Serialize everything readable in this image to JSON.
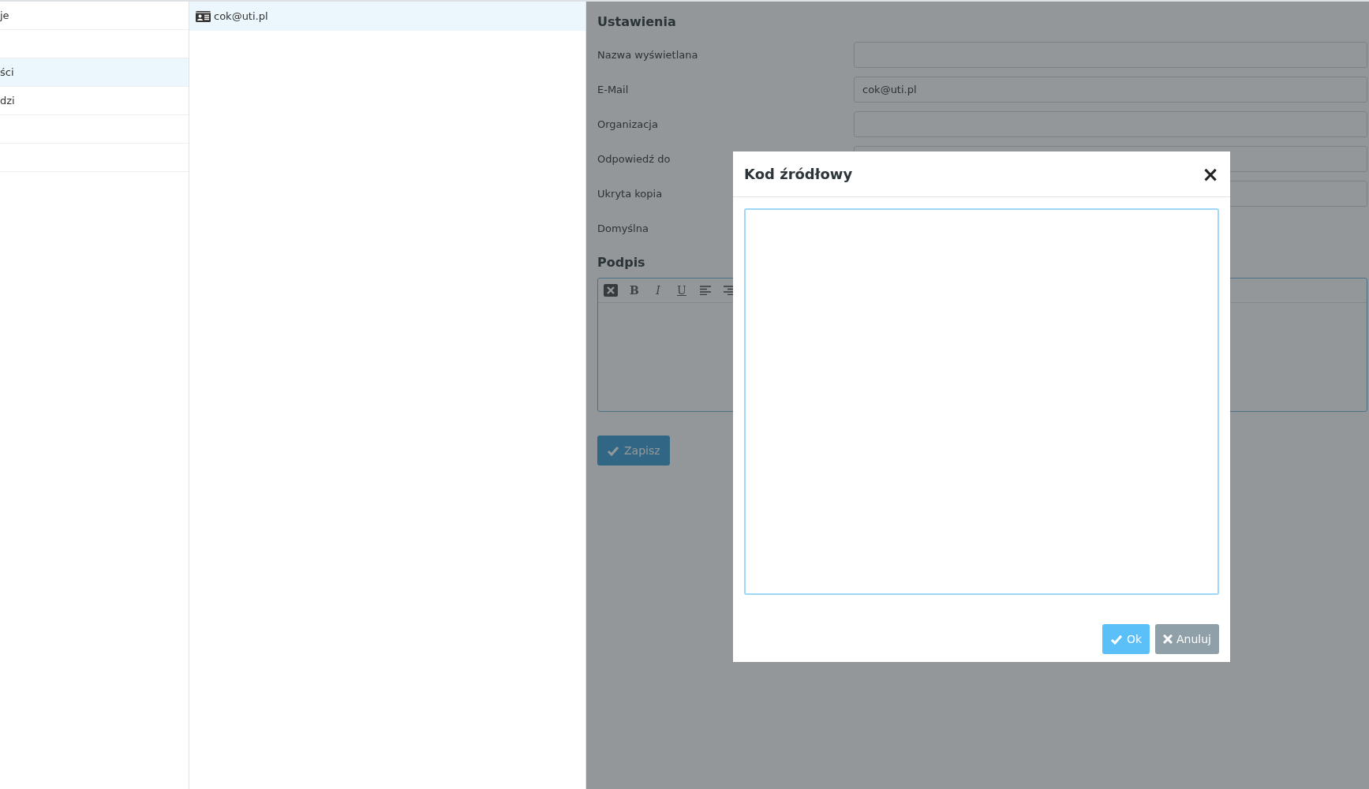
{
  "sidebar": {
    "items": [
      {
        "label": "je",
        "selected": false
      },
      {
        "selected": false
      },
      {
        "label": "ści",
        "selected": true
      },
      {
        "label": "dzi",
        "selected": false
      },
      {
        "selected": false
      },
      {
        "selected": false
      }
    ]
  },
  "identities": {
    "items": [
      {
        "label": "cok@uti.pl",
        "selected": true
      }
    ]
  },
  "settings": {
    "title": "Ustawienia",
    "fields": [
      {
        "label": "Nazwa wyświetlana",
        "kind": "input"
      },
      {
        "label": "E-Mail",
        "kind": "input",
        "value": "cok@uti.pl"
      },
      {
        "label": "Organizacja",
        "kind": "input"
      },
      {
        "label": "Odpowiedź do",
        "kind": "input"
      },
      {
        "label": "Ukryta kopia",
        "kind": "input"
      },
      {
        "label": "Domyślna",
        "kind": "covered"
      }
    ],
    "signature_title": "Podpis",
    "toolbar": [
      {
        "kind": "clear"
      },
      {
        "kind": "bold",
        "label": "B"
      },
      {
        "kind": "italic",
        "label": "I"
      },
      {
        "kind": "underline",
        "label": "U"
      },
      {
        "kind": "align-left"
      },
      {
        "kind": "align-right"
      }
    ],
    "save_button": "Zapisz"
  },
  "dialog": {
    "title": "Kod źródłowy",
    "close": "×",
    "buttons": [
      {
        "label": "Ok",
        "kind": "primary"
      },
      {
        "label": "Anuluj",
        "kind": "cancel"
      }
    ]
  }
}
